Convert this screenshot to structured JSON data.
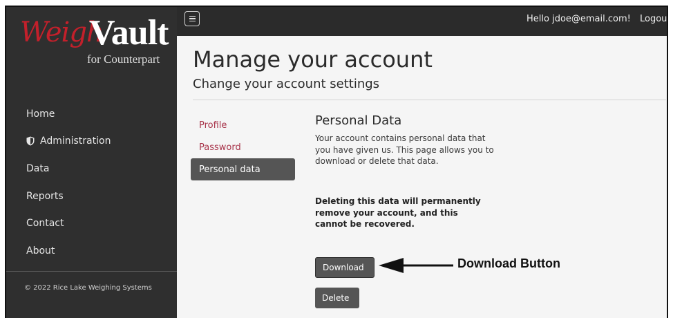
{
  "brand": {
    "logo_script": "Weigh",
    "logo_bold": "Vault",
    "logo_sub": "for Counterpart",
    "accent_color": "#c3202b"
  },
  "sidebar": {
    "items": [
      {
        "label": "Home",
        "icon": null
      },
      {
        "label": "Administration",
        "icon": "shield-icon"
      },
      {
        "label": "Data",
        "icon": null
      },
      {
        "label": "Reports",
        "icon": null
      },
      {
        "label": "Contact",
        "icon": null
      },
      {
        "label": "About",
        "icon": null
      }
    ],
    "copyright": "© 2022 Rice Lake Weighing Systems"
  },
  "topbar": {
    "menu_icon": "hamburger-icon",
    "greeting": "Hello jdoe@email.com!",
    "logout_label": "Logout"
  },
  "page": {
    "title": "Manage your account",
    "subtitle": "Change your account settings"
  },
  "subnav": {
    "items": [
      {
        "label": "Profile",
        "active": false
      },
      {
        "label": "Password",
        "active": false
      },
      {
        "label": "Personal data",
        "active": true
      }
    ]
  },
  "content": {
    "section_title": "Personal Data",
    "description": "Your account contains personal data that you have given us. This page allows you to download or delete that data.",
    "warning": "Deleting this data will permanently remove your account, and this cannot be recovered.",
    "download_label": "Download",
    "delete_label": "Delete"
  },
  "callout": {
    "label": "Download Button"
  }
}
